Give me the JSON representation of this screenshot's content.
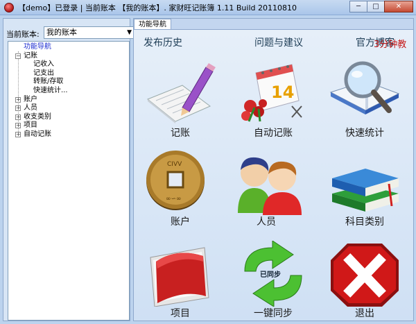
{
  "window": {
    "title": "【demo】已登录 | 当前账本 【我的账本】. 家财旺记账簿 1.11 Build 20110810",
    "minimize": "─",
    "maximize": "□",
    "close": "✕"
  },
  "sidebar": {
    "account_label": "当前账本:",
    "account_value": "我的账本",
    "tree": [
      {
        "label": "功能导航",
        "level": 1,
        "expander": "",
        "selected": true
      },
      {
        "label": "记账",
        "level": 1,
        "expander": "−"
      },
      {
        "label": "记收入",
        "level": 3,
        "expander": ""
      },
      {
        "label": "记支出",
        "level": 3,
        "expander": ""
      },
      {
        "label": "转账/存取",
        "level": 3,
        "expander": ""
      },
      {
        "label": "快速统计...",
        "level": 3,
        "expander": ""
      },
      {
        "label": "账户",
        "level": 1,
        "expander": "+"
      },
      {
        "label": "人员",
        "level": 1,
        "expander": "+"
      },
      {
        "label": "收支类别",
        "level": 1,
        "expander": "+"
      },
      {
        "label": "项目",
        "level": 1,
        "expander": "+"
      },
      {
        "label": "自动记账",
        "level": 1,
        "expander": "+"
      }
    ]
  },
  "main": {
    "tab_label": "功能导航",
    "links": {
      "history": "发布历史",
      "feedback": "问题与建议",
      "website": "官方博客",
      "tutorial": "3分钟教"
    },
    "tiles": [
      {
        "label": "记账",
        "icon": "notepad-pencil-icon"
      },
      {
        "label": "自动记账",
        "icon": "calendar-flowers-icon"
      },
      {
        "label": "快速统计",
        "icon": "magnifier-book-icon"
      },
      {
        "label": "账户",
        "icon": "coin-icon"
      },
      {
        "label": "人员",
        "icon": "people-icon"
      },
      {
        "label": "科目类别",
        "icon": "books-icon"
      },
      {
        "label": "项目",
        "icon": "folder-icon"
      },
      {
        "label": "一键同步",
        "icon": "sync-arrows-icon",
        "overlay": "已同步"
      },
      {
        "label": "退出",
        "icon": "exit-icon"
      }
    ]
  },
  "colors": {
    "accent_blue": "#1a2bd0",
    "link_red": "#c61a1a",
    "exit_red": "#d01818",
    "sync_green": "#3fae2a"
  }
}
